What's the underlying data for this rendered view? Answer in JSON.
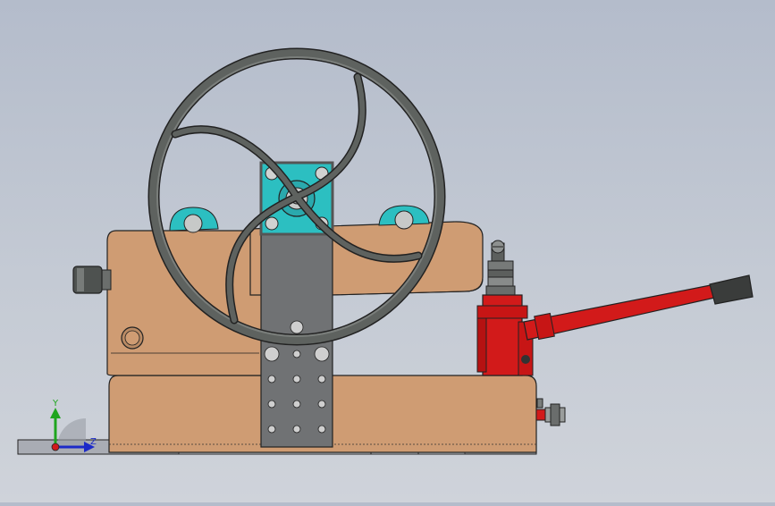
{
  "viewport": {
    "triad": {
      "y_label": "Y",
      "z_label": "Z"
    }
  },
  "colors": {
    "background_top": "#b4bccb",
    "background_bottom": "#cfd3da",
    "body_tan": "#cf9c73",
    "plate_gray": "#707274",
    "handwheel_gray": "#5e625f",
    "bearing_cyan": "#2cbfc1",
    "jack_red": "#d21a1a",
    "handle_black": "#3a3c3b",
    "base_gray": "#a9acb4"
  }
}
